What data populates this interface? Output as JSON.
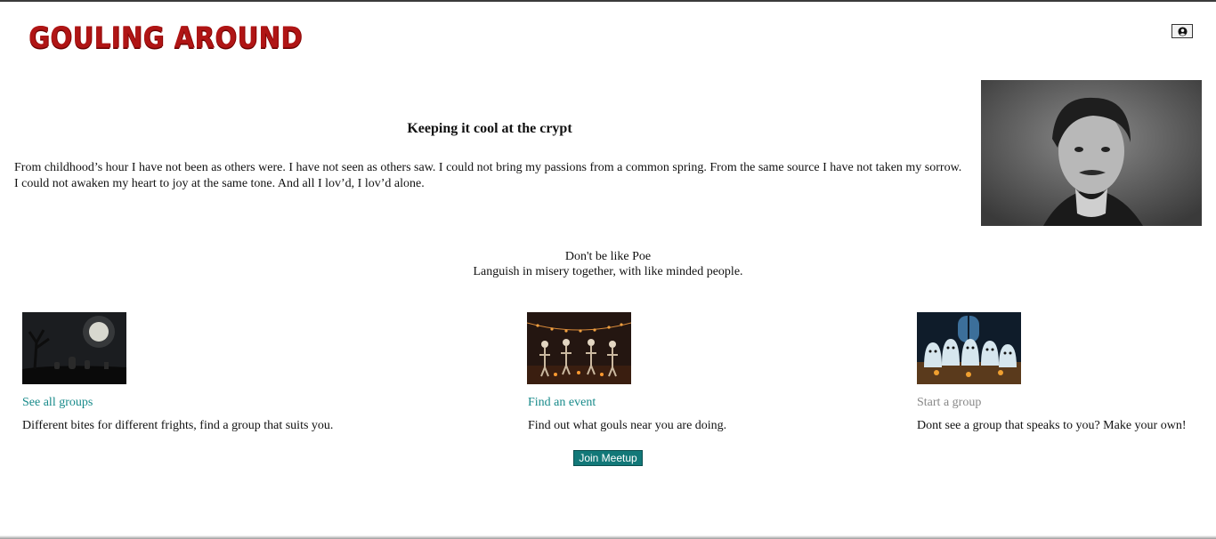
{
  "header": {
    "logo_text": "Gouling Around",
    "account_icon": "user-circle-icon"
  },
  "hero": {
    "title": "Keeping it cool at the crypt",
    "text": "From childhood’s hour I have not been as others were. I have not seen as others saw. I could not bring my passions from a common spring. From the same source I have not taken my sorrow. I could not awaken my heart to joy at the same tone. And all I lov’d, I lov’d alone."
  },
  "tagline": {
    "line1": "Don't be like Poe",
    "line2": "Languish in misery together, with like minded people."
  },
  "cards": [
    {
      "link": "See all groups",
      "desc": "Different bites for different frights, find a group that suits you."
    },
    {
      "link": "Find an event",
      "desc": "Find out what gouls near you are doing."
    },
    {
      "link": "Start a group",
      "desc": "Dont see a group that speaks to you? Make your own!"
    }
  ],
  "join_button": "Join Meetup",
  "colors": {
    "logo": "#b01515",
    "link": "#178a8a",
    "link_muted": "#888888",
    "button": "#127878"
  }
}
